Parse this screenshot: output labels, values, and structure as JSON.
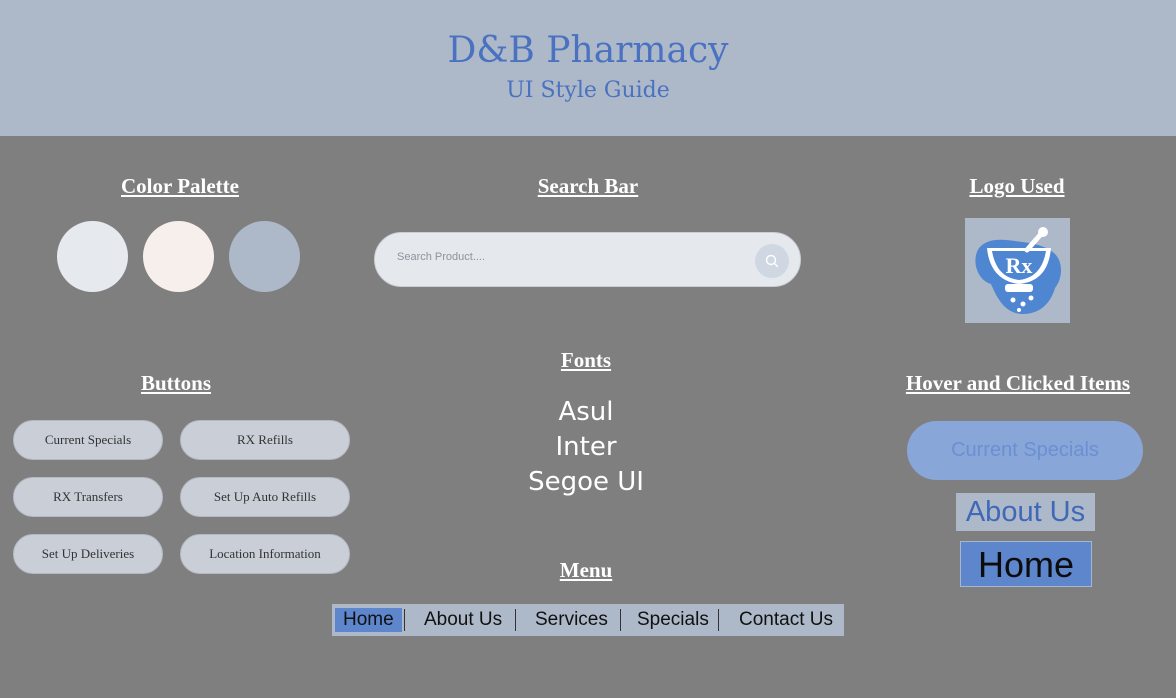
{
  "header": {
    "title": "D&B Pharmacy",
    "subtitle": "UI Style Guide"
  },
  "sections": {
    "color_palette": "Color Palette",
    "search_bar": "Search Bar",
    "logo_used": "Logo Used",
    "buttons": "Buttons",
    "fonts": "Fonts",
    "hover_clicked": "Hover and Clicked Items",
    "menu": "Menu"
  },
  "colors": [
    "#e6e9ee",
    "#f6efec",
    "#adb9c9"
  ],
  "search": {
    "placeholder": "Search Product...."
  },
  "logo": {
    "icon": "rx-mortar-pestle-icon",
    "text": "Rx"
  },
  "buttons": [
    "Current Specials",
    "RX Refills",
    "RX Transfers",
    "Set Up Auto Refills",
    "Set Up Deliveries",
    "Location Information"
  ],
  "fonts": [
    "Asul",
    "Inter",
    "Segoe UI"
  ],
  "hover": {
    "current_specials": "Current Specials",
    "about_us": "About Us",
    "home": "Home"
  },
  "menu": [
    "Home",
    "About Us",
    "Services",
    "Specials",
    "Contact Us"
  ]
}
